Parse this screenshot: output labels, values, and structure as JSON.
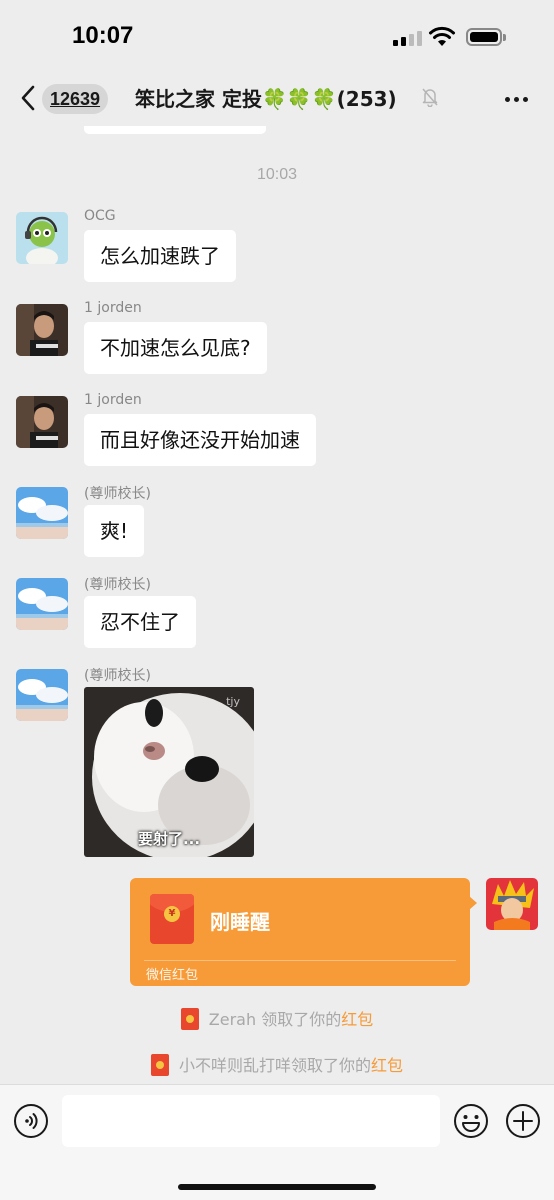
{
  "status_bar": {
    "time": "10:07"
  },
  "nav": {
    "unread_count": "12639",
    "title": "笨比之家 定投🍀🍀🍀(253)"
  },
  "chat": {
    "timestamp": "10:03",
    "messages": [
      {
        "sender": "OCG",
        "text": "怎么加速跌了"
      },
      {
        "sender": "1 jorden",
        "text": "不加速怎么见底?"
      },
      {
        "sender": "1 jorden",
        "text": "而且好像还没开始加速"
      },
      {
        "sender": "(尊师校长)",
        "text": "爽!"
      },
      {
        "sender": "(尊师校长)",
        "text": "忍不住了"
      },
      {
        "sender": "(尊师校长)",
        "sticker_caption": "要射了...",
        "sticker_watermark": "tjy"
      }
    ],
    "red_packet": {
      "title": "刚睡醒",
      "label": "微信红包"
    },
    "system_notices": [
      {
        "prefix": "Zerah 领取了你的",
        "highlight": "红包"
      },
      {
        "prefix": "小不咩则乱打咩领取了你的",
        "highlight": "红包"
      }
    ]
  },
  "input_bar": {
    "value": ""
  },
  "colors": {
    "background": "#ededed",
    "bubble": "#ffffff",
    "red_packet": "#f79b39",
    "highlight": "#f79b39"
  }
}
